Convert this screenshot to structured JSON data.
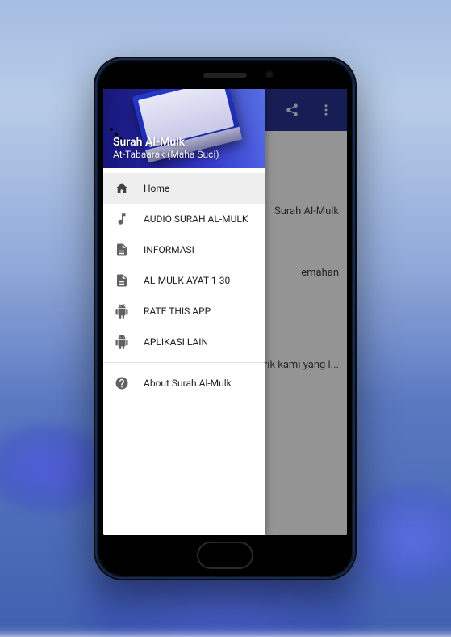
{
  "drawer": {
    "title": "Surah Al-Mulk",
    "subtitle": "At-Tabaarak (Maha Suci)",
    "items": [
      {
        "icon": "home",
        "label": "Home",
        "active": true
      },
      {
        "icon": "music",
        "label": "AUDIO SURAH AL-MULK",
        "active": false
      },
      {
        "icon": "doc",
        "label": "INFORMASI",
        "active": false
      },
      {
        "icon": "doc",
        "label": "AL-MULK AYAT 1-30",
        "active": false
      },
      {
        "icon": "android",
        "label": "RATE THIS APP",
        "active": false
      },
      {
        "icon": "android",
        "label": "APLIKASI LAIN",
        "active": false
      }
    ],
    "footer": {
      "icon": "help",
      "label": "About Surah Al-Mulk"
    }
  },
  "appbar": {
    "share_icon": "share",
    "overflow_icon": "overflow"
  },
  "background_content": {
    "line1": "Surah Al-Mulk",
    "line2": "emahan",
    "line3": "arik kami yang l..."
  }
}
